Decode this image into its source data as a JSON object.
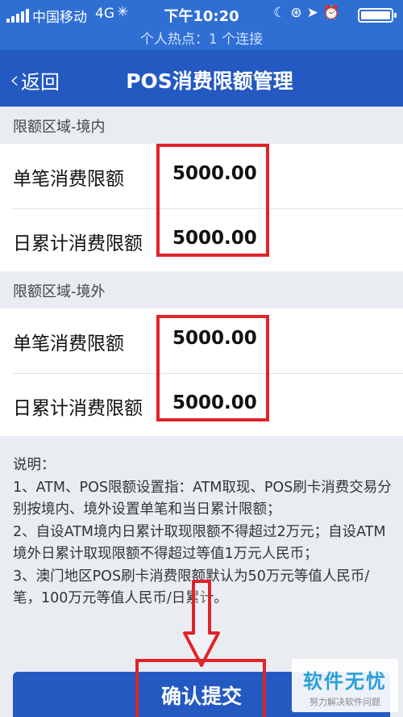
{
  "status_bar": {
    "carrier": "中国移动",
    "network": "4G",
    "time": "下午10:20",
    "hotspot": "个人热点：1 个连接"
  },
  "nav": {
    "back_label": "返回",
    "title": "POS消费限额管理"
  },
  "domestic": {
    "header": "限额区域-境内",
    "rows": [
      {
        "label": "单笔消费限额",
        "value": "5000.00"
      },
      {
        "label": "日累计消费限额",
        "value": "5000.00"
      }
    ]
  },
  "overseas": {
    "header": "限额区域-境外",
    "rows": [
      {
        "label": "单笔消费限额",
        "value": "5000.00"
      },
      {
        "label": "日累计消费限额",
        "value": "5000.00"
      }
    ]
  },
  "notes": {
    "title": "说明：",
    "lines": [
      "1、ATM、POS限额设置指：ATM取现、POS刷卡消费交易分别按境内、境外设置单笔和当日累计限额；",
      "2、自设ATM境内日累计取现限额不得超过2万元；自设ATM境外日累计取现限额不得超过等值1万元人民币；",
      "3、澳门地区POS刷卡消费限额默认为50万元等值人民币/笔，100万元等值人民币/日累计。"
    ]
  },
  "submit_label": "确认提交",
  "watermark": {
    "title": "软件无忧",
    "subtitle": "努力解决软件问题"
  },
  "colors": {
    "status_bar": "#2f6fd4",
    "nav_bar": "#2359c1",
    "highlight": "#e0232a",
    "page_bg": "#e9edf2"
  }
}
